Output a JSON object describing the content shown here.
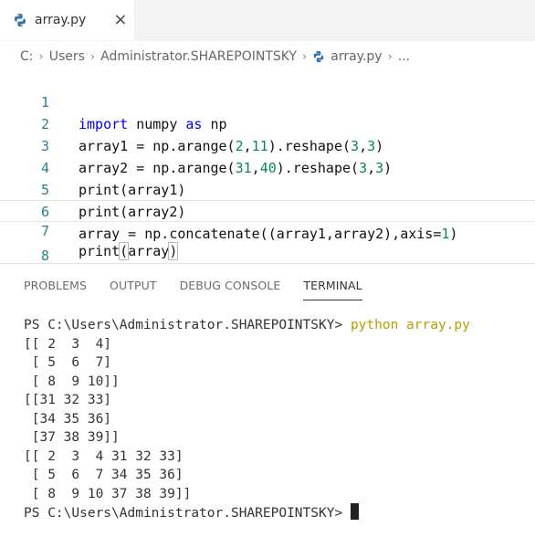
{
  "tab": {
    "label": "array.py",
    "close": "×"
  },
  "breadcrumb": [
    "C:",
    "Users",
    "Administrator.SHAREPOINTSKY",
    "array.py",
    "..."
  ],
  "editor": {
    "lines": [
      {
        "n": "1",
        "text": "import numpy as np"
      },
      {
        "n": "2",
        "text": "array1 = np.arange(2,11).reshape(3,3)"
      },
      {
        "n": "3",
        "text": "array2 = np.arange(31,40).reshape(3,3)"
      },
      {
        "n": "4",
        "text": "print(array1)"
      },
      {
        "n": "5",
        "text": "print(array2)"
      },
      {
        "n": "6",
        "text": "array = np.concatenate((array1,array2),axis=1)"
      },
      {
        "n": "7",
        "text": "print(array)"
      },
      {
        "n": "8",
        "text": ""
      }
    ]
  },
  "panel": {
    "tabs": [
      "PROBLEMS",
      "OUTPUT",
      "DEBUG CONSOLE",
      "TERMINAL"
    ]
  },
  "terminal": {
    "prompt": "PS C:\\Users\\Administrator.SHAREPOINTSKY>",
    "command": "python array.py",
    "output": [
      "[[ 2  3  4]",
      " [ 5  6  7]",
      " [ 8  9 10]]",
      "[[31 32 33]",
      " [34 35 36]",
      " [37 38 39]]",
      "[[ 2  3  4 31 32 33]",
      " [ 5  6  7 34 35 36]",
      " [ 8  9 10 37 38 39]]"
    ]
  }
}
